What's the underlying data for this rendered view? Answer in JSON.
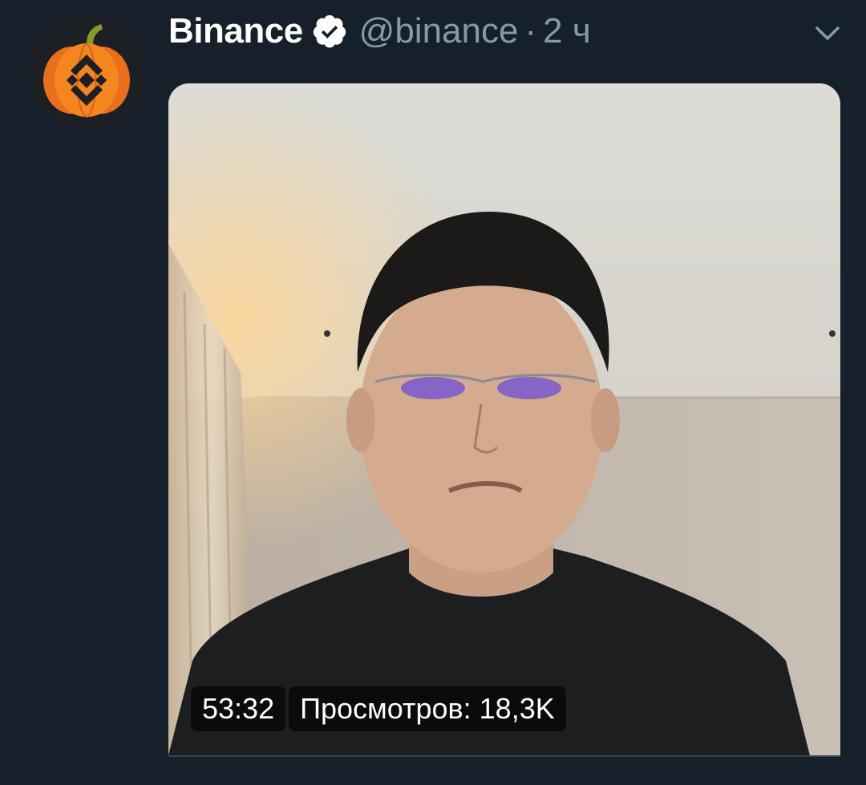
{
  "tweet": {
    "display_name": "Binance",
    "handle": "@binance",
    "separator": "·",
    "time": "2 ч",
    "avatar_icon": "binance-pumpkin-logo",
    "verified_icon": "verified-badge-icon",
    "more_icon": "chevron-down-icon"
  },
  "media": {
    "duration": "53:32",
    "views": "Просмотров: 18,3K",
    "type": "video"
  },
  "colors": {
    "background": "#15202b",
    "secondary_text": "#8899a6",
    "pumpkin": "#f07b1d",
    "binance_logo": "#1c1f24"
  }
}
